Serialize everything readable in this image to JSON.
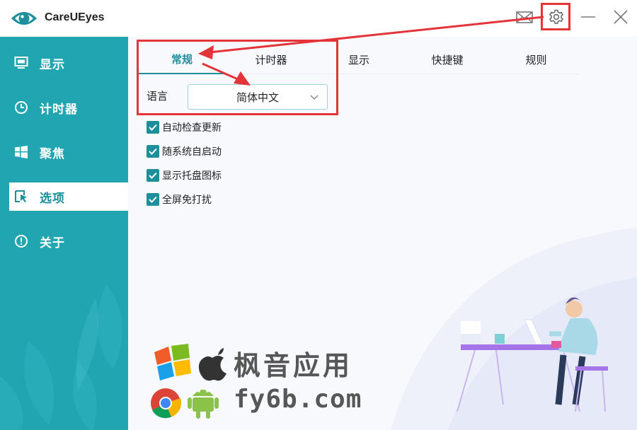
{
  "app": {
    "title": "CareUEyes"
  },
  "titlebar": {
    "icons": [
      "mail-icon",
      "gear-icon",
      "minimize-icon",
      "close-icon"
    ]
  },
  "sidebar": {
    "items": [
      {
        "label": "显示",
        "icon": "monitor-icon",
        "active": false
      },
      {
        "label": "计时器",
        "icon": "clock-icon",
        "active": false
      },
      {
        "label": "聚焦",
        "icon": "windows-icon",
        "active": false
      },
      {
        "label": "选项",
        "icon": "cursor-icon",
        "active": true
      },
      {
        "label": "关于",
        "icon": "info-icon",
        "active": false
      }
    ]
  },
  "tabs": [
    {
      "label": "常规",
      "active": true
    },
    {
      "label": "计时器",
      "active": false
    },
    {
      "label": "显示",
      "active": false
    },
    {
      "label": "快捷键",
      "active": false
    },
    {
      "label": "规则",
      "active": false
    }
  ],
  "language": {
    "label": "语言",
    "selected": "简体中文"
  },
  "options": [
    {
      "label": "自动检查更新",
      "checked": true
    },
    {
      "label": "随系统自启动",
      "checked": true
    },
    {
      "label": "显示托盘图标",
      "checked": true
    },
    {
      "label": "全屏免打扰",
      "checked": true
    }
  ],
  "watermark": {
    "line1": "枫音应用",
    "line2": "fy6b.com"
  },
  "colors": {
    "accent": "#1d8f9b",
    "sidebar": "#20a5b1",
    "annotation": "#e3343a"
  }
}
